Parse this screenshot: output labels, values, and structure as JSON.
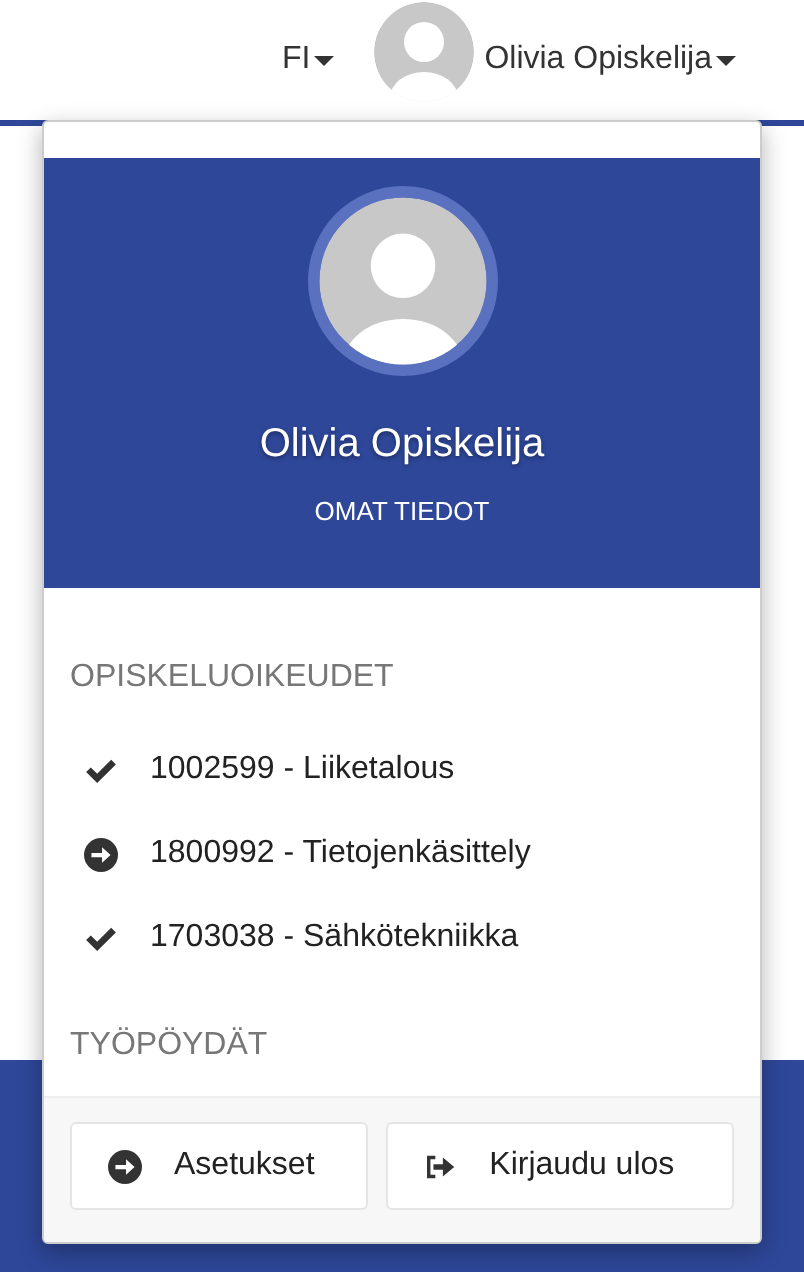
{
  "navbar": {
    "language": "FI",
    "user_name": "Olivia Opiskelija"
  },
  "profile": {
    "name": "Olivia Opiskelija",
    "link": "OMAT TIEDOT"
  },
  "sections": [
    {
      "title": "OPISKELUOIKEUDET",
      "items": [
        {
          "kind": "check",
          "label": "1002599 - Liiketalous"
        },
        {
          "kind": "arrow",
          "label": "1800992 - Tietojenkäsittely"
        },
        {
          "kind": "check",
          "label": "1703038 - Sähkötekniikka"
        }
      ]
    },
    {
      "title": "TYÖPÖYDÄT"
    }
  ],
  "buttons": [
    {
      "kind": "arrow",
      "label": "Asetukset"
    },
    {
      "kind": "logout",
      "label": "Kirjaudu ulos"
    }
  ]
}
